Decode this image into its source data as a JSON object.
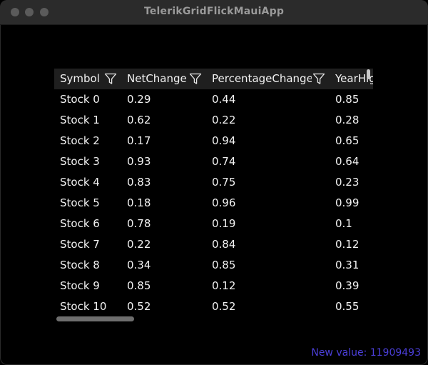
{
  "window": {
    "title": "TelerikGridFlickMauiApp"
  },
  "grid": {
    "columns": [
      {
        "label": "Symbol"
      },
      {
        "label": "NetChange"
      },
      {
        "label": "PercentageChange"
      },
      {
        "label": "YearHig"
      }
    ],
    "rows": [
      [
        "Stock 0",
        "0.29",
        "0.44",
        "0.85"
      ],
      [
        "Stock 1",
        "0.62",
        "0.22",
        "0.28"
      ],
      [
        "Stock 2",
        "0.17",
        "0.94",
        "0.65"
      ],
      [
        "Stock 3",
        "0.93",
        "0.74",
        "0.64"
      ],
      [
        "Stock 4",
        "0.83",
        "0.75",
        "0.23"
      ],
      [
        "Stock 5",
        "0.18",
        "0.96",
        "0.99"
      ],
      [
        "Stock 6",
        "0.78",
        "0.19",
        "0.1"
      ],
      [
        "Stock 7",
        "0.22",
        "0.84",
        "0.12"
      ],
      [
        "Stock 8",
        "0.34",
        "0.85",
        "0.31"
      ],
      [
        "Stock 9",
        "0.85",
        "0.12",
        "0.39"
      ],
      [
        "Stock 10",
        "0.52",
        "0.52",
        "0.55"
      ]
    ]
  },
  "status": {
    "new_value": "New value: 11909493"
  },
  "icons": {
    "filter": "filter-icon"
  },
  "colors": {
    "status_text": "#4b3fd9",
    "header_bg": "#1f1f1f",
    "background": "#000000"
  }
}
